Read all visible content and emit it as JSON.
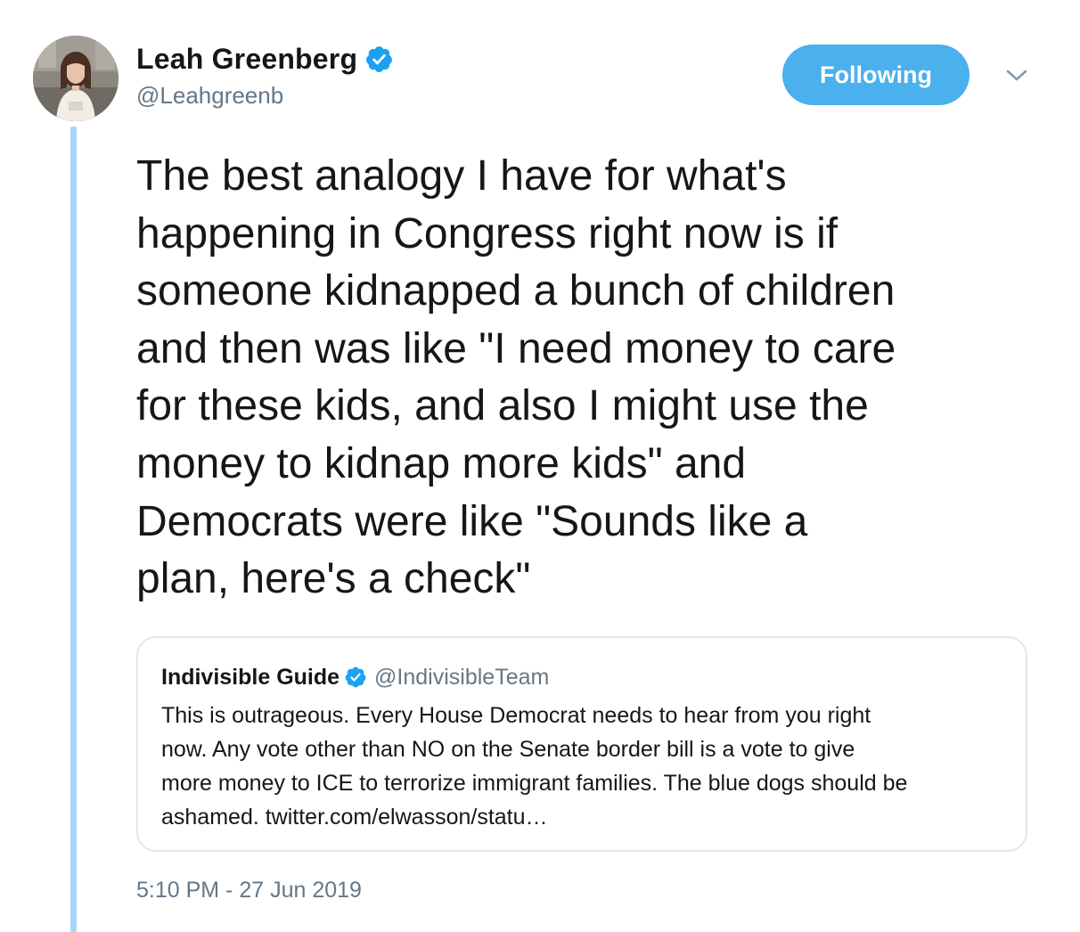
{
  "author": {
    "display_name": "Leah Greenberg",
    "handle": "@Leahgreenb",
    "verified": true
  },
  "follow_button": {
    "label": "Following"
  },
  "tweet": {
    "text": "The best analogy I have for what's\nhappening in Congress right now is if\nsomeone kidnapped a bunch of children\nand then was like \"I need money to care\nfor these kids, and also I might use the\nmoney to kidnap more kids\" and\nDemocrats were like \"Sounds like a\nplan, here's a check\"",
    "timestamp": "5:10 PM - 27 Jun 2019"
  },
  "quoted_tweet": {
    "display_name": "Indivisible Guide",
    "handle": "@IndivisibleTeam",
    "verified": true,
    "text": "This is outrageous. Every House Democrat needs to hear from you right\nnow. Any vote other than NO on the Senate border bill is a vote to give\nmore money to ICE to terrorize immigrant families. The blue dogs should be\nashamed. twitter.com/elwasson/statu…"
  },
  "colors": {
    "accent": "#4bb0ee",
    "verified": "#1da1f2",
    "thread_line": "#a9d6f5",
    "secondary_text": "#657786",
    "border": "#e1e8ed"
  },
  "icons": {
    "verified": "verified-badge-icon",
    "caret": "chevron-down-icon"
  }
}
